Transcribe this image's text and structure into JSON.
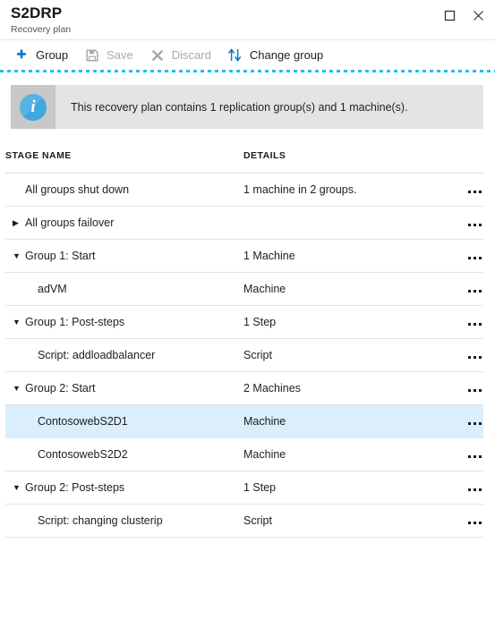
{
  "window": {
    "title": "S2DRP",
    "subtitle": "Recovery plan",
    "controls": [
      {
        "name": "maximize-button",
        "icon": "maximize-icon"
      },
      {
        "name": "close-button",
        "icon": "close-icon"
      }
    ]
  },
  "toolbar": {
    "items": [
      {
        "label": "Group",
        "icon": "plus-icon",
        "enabled": true
      },
      {
        "label": "Save",
        "icon": "save-icon",
        "enabled": false
      },
      {
        "label": "Discard",
        "icon": "discard-icon",
        "enabled": false
      },
      {
        "label": "Change group",
        "icon": "change-group-icon",
        "enabled": true
      }
    ]
  },
  "banner": {
    "icon": "info-icon",
    "glyph": "i",
    "message": "This recovery plan contains 1 replication group(s) and 1 machine(s)."
  },
  "table": {
    "columns": [
      "STAGE NAME",
      "DETAILS"
    ],
    "rows": [
      {
        "name": "All groups shut down",
        "details": "1 machine in 2 groups.",
        "toggle": "",
        "indent": 0,
        "selected": false,
        "actions": "ellipsis-icon"
      },
      {
        "name": "All groups failover",
        "details": "",
        "toggle": "▶",
        "indent": 0,
        "selected": false,
        "actions": "ellipsis-icon"
      },
      {
        "name": "Group 1: Start",
        "details": "1 Machine",
        "toggle": "▼",
        "indent": 0,
        "selected": false,
        "actions": "ellipsis-icon"
      },
      {
        "name": "adVM",
        "details": "Machine",
        "toggle": "",
        "indent": 1,
        "selected": false,
        "actions": "ellipsis-icon"
      },
      {
        "name": "Group 1: Post-steps",
        "details": "1 Step",
        "toggle": "▼",
        "indent": 0,
        "selected": false,
        "actions": "ellipsis-icon"
      },
      {
        "name": "Script: addloadbalancer",
        "details": "Script",
        "toggle": "",
        "indent": 1,
        "selected": false,
        "actions": "ellipsis-icon"
      },
      {
        "name": "Group 2: Start",
        "details": "2 Machines",
        "toggle": "▼",
        "indent": 0,
        "selected": false,
        "actions": "ellipsis-icon"
      },
      {
        "name": "ContosowebS2D1",
        "details": "Machine",
        "toggle": "",
        "indent": 1,
        "selected": true,
        "actions": "ellipsis-icon"
      },
      {
        "name": "ContosowebS2D2",
        "details": "Machine",
        "toggle": "",
        "indent": 1,
        "selected": false,
        "actions": "ellipsis-icon"
      },
      {
        "name": "Group 2: Post-steps",
        "details": "1 Step",
        "toggle": "▼",
        "indent": 0,
        "selected": false,
        "actions": "ellipsis-icon"
      },
      {
        "name": "Script: changing clusterip",
        "details": "Script",
        "toggle": "",
        "indent": 1,
        "selected": false,
        "actions": "ellipsis-icon"
      }
    ]
  },
  "colors": {
    "accent": "#0078d4",
    "dashed_rule": "#22bdf5",
    "selection": "#daeefc",
    "banner_bg": "#e4e4e4",
    "banner_icon_bg": "#c8c8c8",
    "info_blue": "#3fa9dd",
    "disabled_text": "#a9a9a9"
  }
}
